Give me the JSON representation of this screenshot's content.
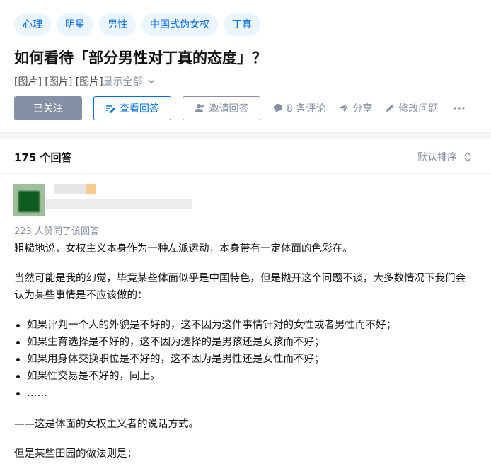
{
  "question": {
    "topics": [
      "心理",
      "明星",
      "男性",
      "中国式伪女权",
      "丁真"
    ],
    "title": "如何看待「部分男性对丁真的态度」？",
    "detail_text": "[图片] [图片] [图片]",
    "show_all_label": "显示全部",
    "actions": {
      "followed_label": "已关注",
      "view_answers_label": "查看回答",
      "invite_label": "邀请回答",
      "comments_label": "8 条评论",
      "share_label": "分享",
      "edit_label": "修改问题"
    }
  },
  "answers": {
    "count_label": "175 个回答",
    "sort_label": "默认排序"
  },
  "answer": {
    "voters_label": "223 人赞同了该回答",
    "paragraphs": [
      "粗糙地说，女权主义本身作为一种左派运动，本身带有一定体面的色彩在。",
      "当然可能是我的幻觉，毕竟某些体面似乎是中国特色，但是抛开这个问题不谈，大多数情况下我们会认为某些事情是不应该做的："
    ],
    "bullets": [
      "如果评判一个人的外貌是不好的，这不因为这件事情针对的女性或者男性而不好；",
      "如果生育选择是不好的，这不因为选择的是男孩还是女孩而不好；",
      "如果用身体交换职位是不好的，这不因为是男性还是女性而不好；",
      "如果性交易是不好的，同上。",
      "……"
    ],
    "paragraph_after_1": "——这是体面的女权主义者的说话方式。",
    "paragraph_after_2": "但是某些田园的做法则是："
  },
  "colors": {
    "brand_blue": "#056de8",
    "topic_bg": "#ebf5ff",
    "muted_gray": "#8590a6"
  }
}
